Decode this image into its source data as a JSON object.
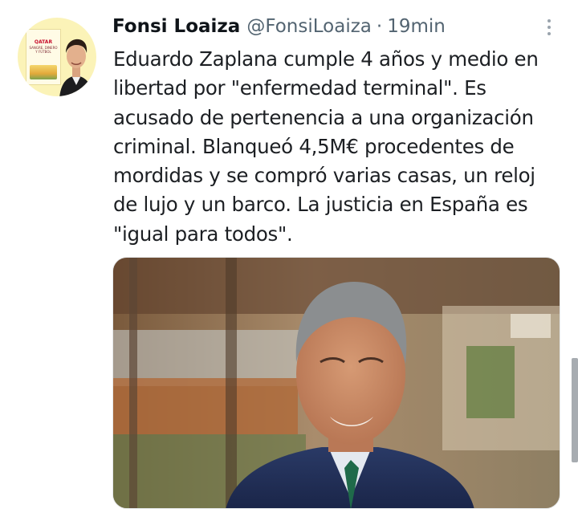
{
  "tweet": {
    "author_name": "Fonsi Loaiza",
    "handle": "@FonsiLoaiza",
    "separator": "·",
    "time": "19min",
    "text": "Eduardo Zaplana cumple 4 años y medio en libertad por \"enfermedad terminal\". Es acusado de pertenencia a una organización criminal. Blanqueó 4,5M€ procedentes de mordidas y se compró varias casas, un reloj de lujo y un barco. La justicia en España es \"igual para todos\"."
  },
  "avatar": {
    "cover_title": "QATAR",
    "cover_subtitle": "SANGRE, DINERO Y FÚTBOL"
  },
  "icons": {
    "more": "more-vertical-icon"
  },
  "colors": {
    "text": "#0f1419",
    "secondary": "#536471",
    "background": "#ffffff"
  }
}
